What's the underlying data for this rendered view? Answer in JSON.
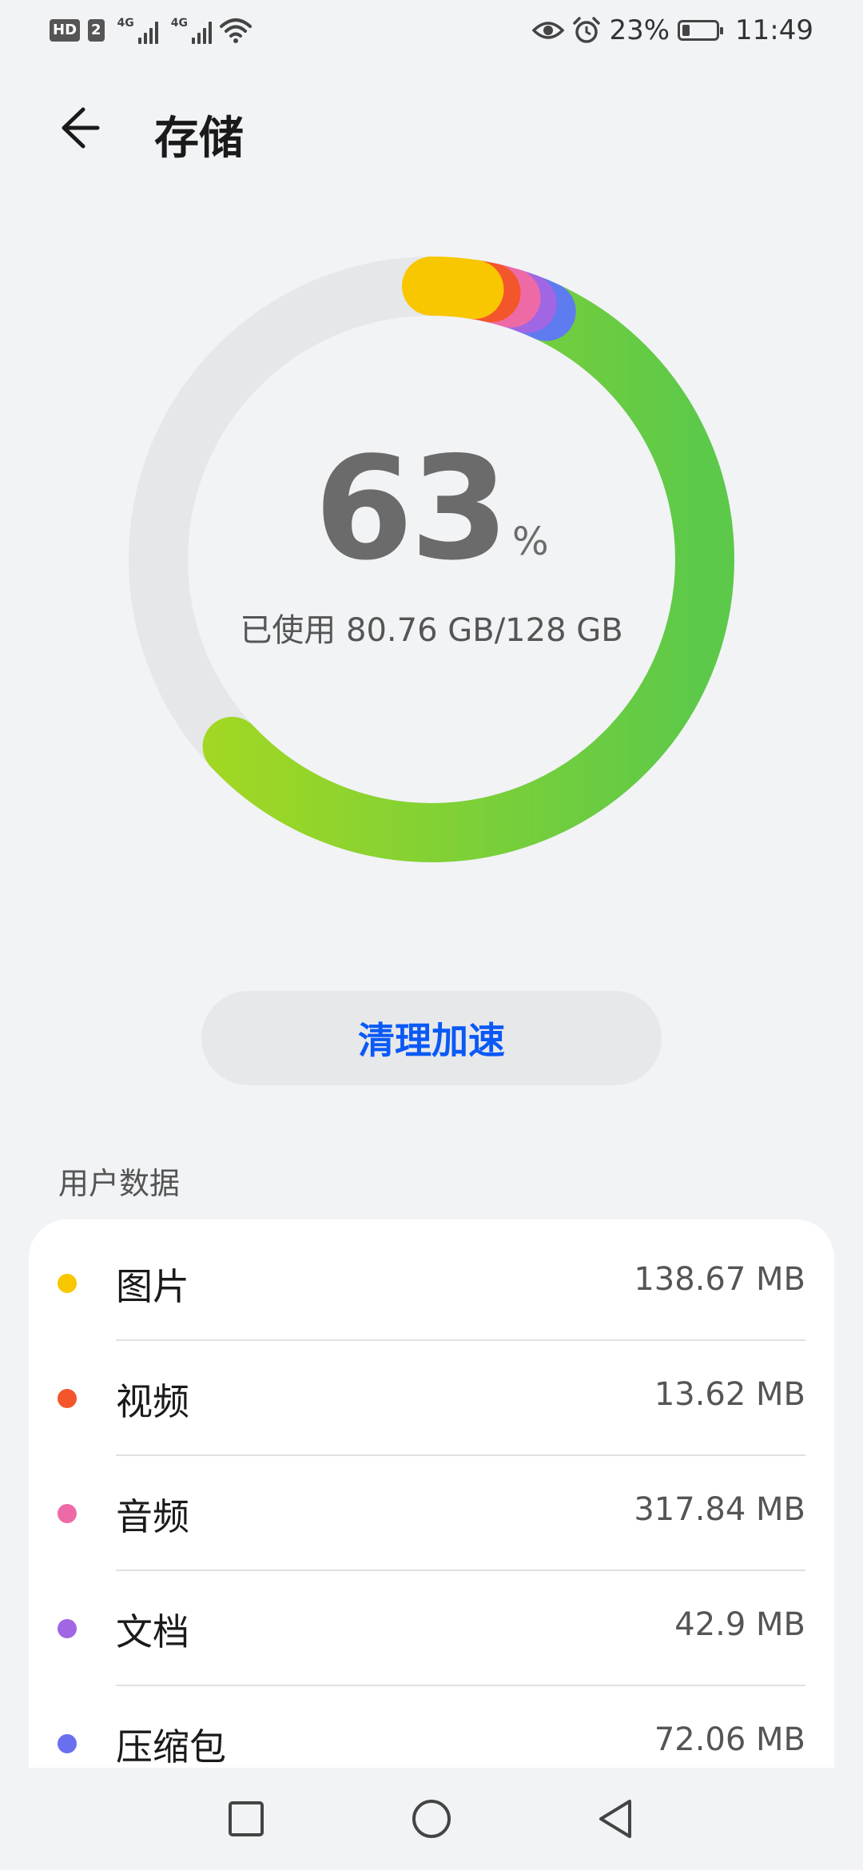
{
  "status_bar": {
    "hd_label": "HD",
    "sim_label": "2",
    "network1": "4G",
    "network2": "4G",
    "battery_percent_text": "23%",
    "battery_level": 0.23,
    "time": "11:49",
    "icons": [
      "hd-icon",
      "sim2-icon",
      "signal-icon",
      "signal-icon",
      "wifi-icon",
      "eye-comfort-icon",
      "alarm-icon",
      "battery-icon"
    ]
  },
  "header": {
    "title": "存储",
    "back_icon": "arrow-left-icon"
  },
  "storage": {
    "percent_value": "63",
    "percent_sign": "%",
    "used_text": "已使用 80.76 GB/128 GB",
    "used_fraction": 0.63,
    "track_color": "#e6e7e9",
    "segments": [
      {
        "name": "图片",
        "color": "#f8c700",
        "fraction": 0.025
      },
      {
        "name": "视频",
        "color": "#f4562c",
        "fraction": 0.01
      },
      {
        "name": "音频",
        "color": "#ee6aa7",
        "fraction": 0.012
      },
      {
        "name": "文档",
        "color": "#a066e3",
        "fraction": 0.01
      },
      {
        "name": "压缩包",
        "color": "#5e7bf0",
        "fraction": 0.012
      },
      {
        "name": "other",
        "color": "#8bd42b",
        "fraction": 0.561
      }
    ]
  },
  "actions": {
    "clean_label": "清理加速"
  },
  "user_data": {
    "section_title": "用户数据",
    "items": [
      {
        "label": "图片",
        "value": "138.67 MB",
        "color": "#f8c700"
      },
      {
        "label": "视频",
        "value": "13.62 MB",
        "color": "#f4562c"
      },
      {
        "label": "音频",
        "value": "317.84 MB",
        "color": "#ee6aa7"
      },
      {
        "label": "文档",
        "value": "42.9 MB",
        "color": "#a066e3"
      },
      {
        "label": "压缩包",
        "value": "72.06 MB",
        "color": "#6a6ff0"
      }
    ]
  },
  "navbar": {
    "icons": [
      "recent-apps-icon",
      "home-icon",
      "back-triangle-icon"
    ]
  }
}
